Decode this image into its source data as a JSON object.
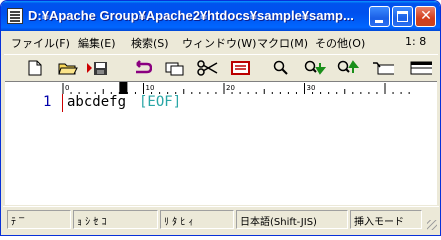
{
  "window": {
    "title": "D:¥Apache Group¥Apache2¥htdocs¥sample¥samp..."
  },
  "menu": {
    "items": [
      {
        "label": "ファイル(F)"
      },
      {
        "label": "編集(E)"
      },
      {
        "label": "検索(S)"
      },
      {
        "label": "ウィンドウ(W)"
      },
      {
        "label": "マクロ(M)"
      },
      {
        "label": "その他(O)"
      }
    ],
    "position": "1: 8"
  },
  "toolbar": {
    "icons": [
      "new-file-icon",
      "open-folder-icon",
      "save-icon",
      "undo-icon",
      "copy-icon",
      "cut-icon",
      "paste-icon",
      "search-icon",
      "search-next-icon",
      "search-prev-icon",
      "jump-icon",
      "window-split-icon"
    ]
  },
  "ruler": {
    "labels": [
      "0",
      "10",
      "20",
      "30"
    ]
  },
  "editor": {
    "line_number": "1",
    "text": "abcdefg",
    "eof": "[EOF]",
    "colors": {
      "line_number": "#0000aa",
      "text": "#000000",
      "eof": "#2aa6a6",
      "gutter": "#cc0000"
    }
  },
  "status": {
    "cells": [
      "ﾃ ‾",
      "ｮ ｼ ｾ ｺ",
      "ﾘ ﾀ ﾋ ｨ",
      "日本語(Shift-JIS)",
      "挿入モード"
    ]
  }
}
